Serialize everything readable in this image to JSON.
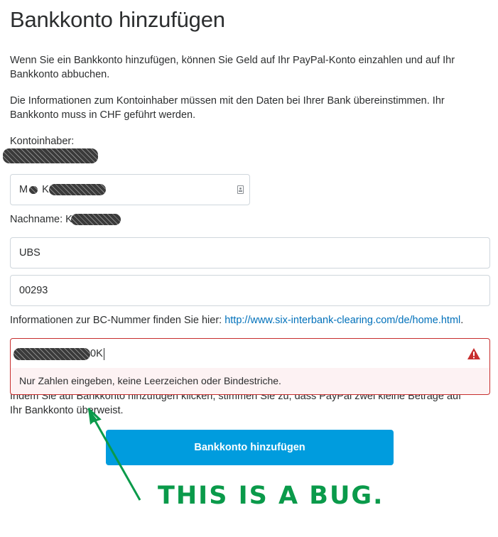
{
  "page": {
    "title": "Bankkonto hinzufügen",
    "intro": "Wenn Sie ein Bankkonto hinzufügen, können Sie Geld auf Ihr PayPal-Konto einzahlen und auf Ihr Bankkonto abbuchen.",
    "notice": "Die Informationen zum Kontoinhaber müssen mit den Daten bei Ihrer Bank übereinstimmen. Ihr Bankkonto muss in CHF geführt werden."
  },
  "form": {
    "account_holder_label": "Kontoinhaber:",
    "name_field_prefix": "M",
    "name_field_initial": "K",
    "surname_label": "Nachname: K",
    "bank_name_value": "UBS",
    "bc_number_value": "00293",
    "bc_info_text": "Informationen zur BC-Nummer finden Sie hier: ",
    "bc_info_link": "http://www.six-interbank-clearing.com/de/home.html",
    "bc_info_suffix": ".",
    "account_number_suffix": "0K",
    "error_message": "Nur Zahlen eingeben, keine Leerzeichen oder Bindestriche.",
    "terms_line1_visible": "Indem Sie auf Bankkonto hinzufügen klicken, stimmen Sie zu, dass PayPal zwei kleine Beträge auf",
    "terms_line2": "Ihr Bankkonto überweist.",
    "submit_label": "Bankkonto hinzufügen"
  },
  "annotation": {
    "text": "THIS IS A BUG.",
    "color": "#0a9a4a"
  },
  "colors": {
    "accent": "#009cde",
    "error": "#c72e2e",
    "link": "#0070ba"
  }
}
